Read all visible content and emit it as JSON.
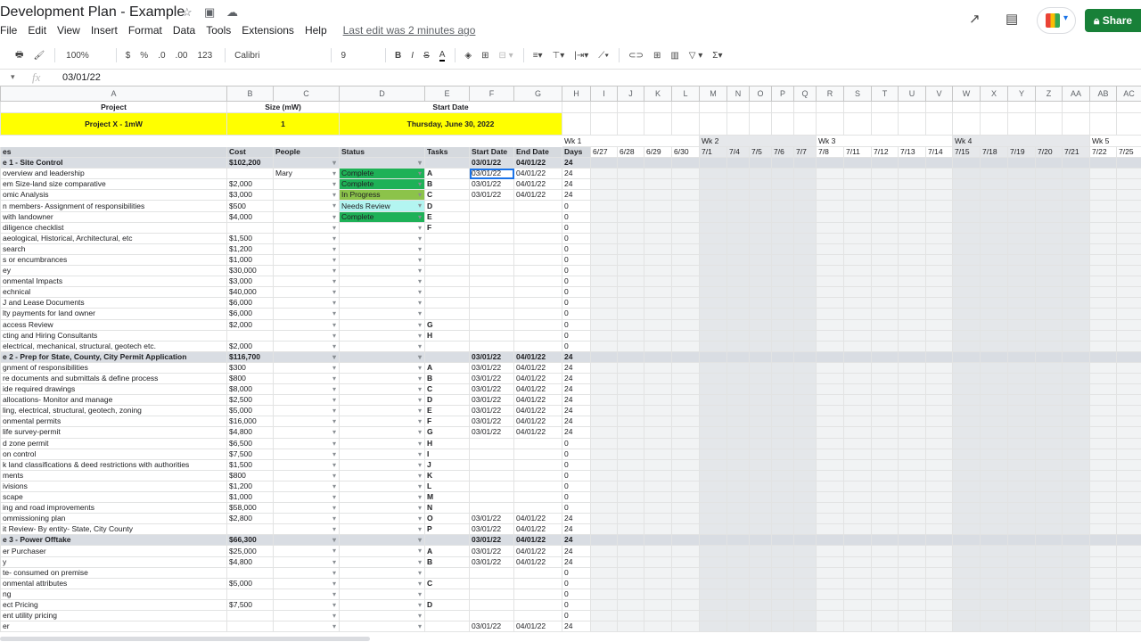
{
  "app": {
    "title": "Development Plan - Example",
    "last_edit": "Last edit was 2 minutes ago",
    "share_label": "Share"
  },
  "menu": [
    "File",
    "Edit",
    "View",
    "Insert",
    "Format",
    "Data",
    "Tools",
    "Extensions",
    "Help"
  ],
  "toolbar": {
    "zoom": "100%",
    "currency": "$",
    "percent": "%",
    "dec_less": ".0",
    "dec_more": ".00",
    "format": "123",
    "font": "Calibri",
    "font_size": "9"
  },
  "formula": {
    "fx": "fx",
    "value": "03/01/22"
  },
  "columns": [
    "A",
    "B",
    "C",
    "D",
    "E",
    "F",
    "G",
    "H",
    "I",
    "J",
    "K",
    "L",
    "M",
    "N",
    "O",
    "P",
    "Q",
    "R",
    "S",
    "T",
    "U",
    "V",
    "W",
    "X",
    "Y",
    "Z",
    "AA",
    "AB",
    "AC"
  ],
  "project": {
    "project_label": "Project",
    "size_label": "Size (mW)",
    "start_label": "Start Date",
    "project": "Project X - 1mW",
    "size": "1",
    "start": "Thursday, June 30, 2022"
  },
  "weeks": [
    "Wk 1",
    "Wk 2",
    "Wk 3",
    "Wk 4",
    "Wk 5"
  ],
  "headers": [
    "es",
    "Cost",
    "People",
    "Status",
    "Tasks",
    "Start Date",
    "End Date",
    "Days"
  ],
  "dates": [
    "6/27",
    "6/28",
    "6/29",
    "6/30",
    "7/1",
    "7/4",
    "7/5",
    "7/6",
    "7/7",
    "7/8",
    "7/11",
    "7/12",
    "7/13",
    "7/14",
    "7/15",
    "7/18",
    "7/19",
    "7/20",
    "7/21",
    "7/22",
    "7/25"
  ],
  "status_colors": {
    "Complete": "#1eb157",
    "In Progress": "#8cc34a",
    "Needs Review": "#b3f5f1"
  },
  "rows": [
    [
      "e 1 - Site Control",
      "$102,200",
      "",
      "",
      "",
      "03/01/22",
      "04/01/22",
      "24",
      "phase"
    ],
    [
      "overview and leadership",
      "",
      "Mary",
      "Complete",
      "A",
      "03/01/22",
      "04/01/22",
      "24"
    ],
    [
      "em Size-land size comparative",
      "$2,000",
      "",
      "Complete",
      "B",
      "03/01/22",
      "04/01/22",
      "24"
    ],
    [
      "omic Analysis",
      "$3,000",
      "",
      "In Progress",
      "C",
      "03/01/22",
      "04/01/22",
      "24"
    ],
    [
      "n members- Assignment of responsibilities",
      "$500",
      "",
      "Needs Review",
      "D",
      "",
      "",
      "0"
    ],
    [
      "with landowner",
      "$4,000",
      "",
      "Complete",
      "E",
      "",
      "",
      "0"
    ],
    [
      "diligence checklist",
      "",
      "",
      "",
      "F",
      "",
      "",
      "0"
    ],
    [
      "aeological, Historical, Architectural, etc",
      "$1,500",
      "",
      "",
      "",
      "",
      "",
      "0"
    ],
    "search",
    "",
    [
      "s or encumbrances",
      "$1,000",
      "",
      "",
      "",
      "",
      "",
      "0"
    ],
    [
      "ey",
      "$30,000",
      "",
      "",
      "",
      "",
      "",
      "0"
    ],
    [
      "onmental Impacts",
      "$3,000",
      "",
      "",
      "",
      "",
      "",
      "0"
    ],
    [
      "echnical",
      "$40,000",
      "",
      "",
      "",
      "",
      "",
      "0"
    ],
    [
      "J and Lease Documents",
      "$6,000",
      "",
      "",
      "",
      "",
      "",
      "0"
    ],
    [
      "lty payments for land owner",
      "$6,000",
      "",
      "",
      "",
      "",
      "",
      "0"
    ],
    [
      "access Review",
      "$2,000",
      "",
      "",
      "G",
      "",
      "",
      "0"
    ],
    [
      "cting and Hiring Consultants",
      "",
      "",
      "",
      "H",
      "",
      "",
      "0"
    ],
    [
      "electrical, mechanical, structural, geotech etc.",
      "$2,000",
      "",
      "",
      "",
      "",
      "",
      "0"
    ],
    [
      "e 2 - Prep for State, County, City Permit Application",
      "$116,700",
      "",
      "",
      "",
      "03/01/22",
      "04/01/22",
      "24",
      "phase"
    ],
    [
      "gnment of responsibilities",
      "$300",
      "",
      "",
      "A",
      "03/01/22",
      "04/01/22",
      "24"
    ],
    [
      "re documents and submittals & define process",
      "$800",
      "",
      "",
      "B",
      "03/01/22",
      "04/01/22",
      "24"
    ],
    [
      "ide required drawings",
      "$8,000",
      "",
      "",
      "C",
      "03/01/22",
      "04/01/22",
      "24"
    ],
    [
      "allocations- Monitor and manage",
      "$2,500",
      "",
      "",
      "D",
      "03/01/22",
      "04/01/22",
      "24"
    ],
    [
      "ling, electrical, structural, geotech, zoning",
      "$5,000",
      "",
      "",
      "E",
      "03/01/22",
      "04/01/22",
      "24"
    ],
    [
      "onmental permits",
      "$16,000",
      "",
      "",
      "F",
      "03/01/22",
      "04/01/22",
      "24"
    ],
    [
      "life survey-permit",
      "$4,800",
      "",
      "",
      "G",
      "03/01/22",
      "04/01/22",
      "24"
    ],
    [
      "d zone permit",
      "$6,500",
      "",
      "",
      "H",
      "",
      "",
      "0"
    ],
    [
      "on control",
      "$7,500",
      "",
      "",
      "I",
      "",
      "",
      "0"
    ],
    [
      "k land classifications & deed restrictions with authorities",
      "$1,500",
      "",
      "",
      "J",
      "",
      "",
      "0"
    ],
    [
      "ments",
      "$800",
      "",
      "",
      "K",
      "",
      "",
      "0"
    ],
    [
      "ivisions",
      "$1,200",
      "",
      "",
      "L",
      "",
      "",
      "0"
    ],
    [
      "scape",
      "$1,000",
      "",
      "",
      "M",
      "",
      "",
      "0"
    ],
    [
      "ing and road improvements",
      "$58,000",
      "",
      "",
      "N",
      "",
      "",
      "0"
    ],
    [
      "ommissioning plan",
      "$2,800",
      "",
      "",
      "O",
      "03/01/22",
      "04/01/22",
      "24"
    ],
    [
      "it Review- By entity- State, City County",
      "",
      "",
      "",
      "P",
      "03/01/22",
      "04/01/22",
      "24"
    ],
    [
      "e 3 - Power Offtake",
      "$66,300",
      "",
      "",
      "",
      "03/01/22",
      "04/01/22",
      "24",
      "phase"
    ],
    [
      "er Purchaser",
      "$25,000",
      "",
      "",
      "A",
      "03/01/22",
      "04/01/22",
      "24"
    ],
    [
      "y",
      "$4,800",
      "",
      "",
      "B",
      "03/01/22",
      "04/01/22",
      "24"
    ],
    [
      "te- consumed on premise",
      "",
      "",
      "",
      "",
      "",
      "",
      "0"
    ],
    [
      "onmental attributes",
      "$5,000",
      "",
      "",
      "C",
      "",
      "",
      "0"
    ],
    [
      "ng",
      "",
      "",
      "",
      "",
      "",
      "",
      "0"
    ],
    [
      "ect Pricing",
      "$7,500",
      "",
      "",
      "D",
      "",
      "",
      "0"
    ],
    [
      "ent utility pricing",
      "",
      "",
      "",
      "",
      "",
      "",
      "0"
    ],
    [
      "er",
      "",
      "",
      "",
      "",
      "03/01/22",
      "04/01/22",
      "24"
    ]
  ]
}
